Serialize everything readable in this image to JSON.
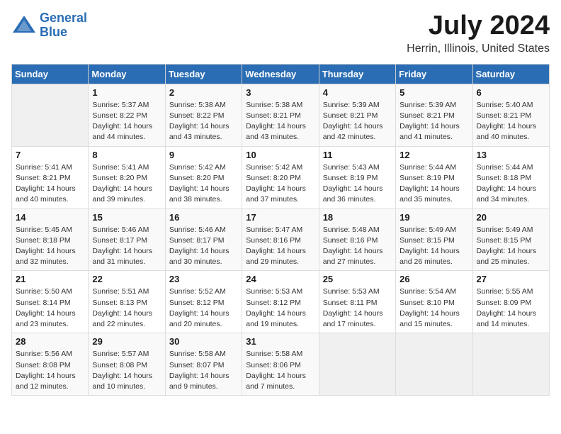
{
  "header": {
    "logo_line1": "General",
    "logo_line2": "Blue",
    "title": "July 2024",
    "location": "Herrin, Illinois, United States"
  },
  "calendar": {
    "days_of_week": [
      "Sunday",
      "Monday",
      "Tuesday",
      "Wednesday",
      "Thursday",
      "Friday",
      "Saturday"
    ],
    "weeks": [
      [
        {
          "day": "",
          "info": ""
        },
        {
          "day": "1",
          "info": "Sunrise: 5:37 AM\nSunset: 8:22 PM\nDaylight: 14 hours\nand 44 minutes."
        },
        {
          "day": "2",
          "info": "Sunrise: 5:38 AM\nSunset: 8:22 PM\nDaylight: 14 hours\nand 43 minutes."
        },
        {
          "day": "3",
          "info": "Sunrise: 5:38 AM\nSunset: 8:21 PM\nDaylight: 14 hours\nand 43 minutes."
        },
        {
          "day": "4",
          "info": "Sunrise: 5:39 AM\nSunset: 8:21 PM\nDaylight: 14 hours\nand 42 minutes."
        },
        {
          "day": "5",
          "info": "Sunrise: 5:39 AM\nSunset: 8:21 PM\nDaylight: 14 hours\nand 41 minutes."
        },
        {
          "day": "6",
          "info": "Sunrise: 5:40 AM\nSunset: 8:21 PM\nDaylight: 14 hours\nand 40 minutes."
        }
      ],
      [
        {
          "day": "7",
          "info": "Sunrise: 5:41 AM\nSunset: 8:21 PM\nDaylight: 14 hours\nand 40 minutes."
        },
        {
          "day": "8",
          "info": "Sunrise: 5:41 AM\nSunset: 8:20 PM\nDaylight: 14 hours\nand 39 minutes."
        },
        {
          "day": "9",
          "info": "Sunrise: 5:42 AM\nSunset: 8:20 PM\nDaylight: 14 hours\nand 38 minutes."
        },
        {
          "day": "10",
          "info": "Sunrise: 5:42 AM\nSunset: 8:20 PM\nDaylight: 14 hours\nand 37 minutes."
        },
        {
          "day": "11",
          "info": "Sunrise: 5:43 AM\nSunset: 8:19 PM\nDaylight: 14 hours\nand 36 minutes."
        },
        {
          "day": "12",
          "info": "Sunrise: 5:44 AM\nSunset: 8:19 PM\nDaylight: 14 hours\nand 35 minutes."
        },
        {
          "day": "13",
          "info": "Sunrise: 5:44 AM\nSunset: 8:18 PM\nDaylight: 14 hours\nand 34 minutes."
        }
      ],
      [
        {
          "day": "14",
          "info": "Sunrise: 5:45 AM\nSunset: 8:18 PM\nDaylight: 14 hours\nand 32 minutes."
        },
        {
          "day": "15",
          "info": "Sunrise: 5:46 AM\nSunset: 8:17 PM\nDaylight: 14 hours\nand 31 minutes."
        },
        {
          "day": "16",
          "info": "Sunrise: 5:46 AM\nSunset: 8:17 PM\nDaylight: 14 hours\nand 30 minutes."
        },
        {
          "day": "17",
          "info": "Sunrise: 5:47 AM\nSunset: 8:16 PM\nDaylight: 14 hours\nand 29 minutes."
        },
        {
          "day": "18",
          "info": "Sunrise: 5:48 AM\nSunset: 8:16 PM\nDaylight: 14 hours\nand 27 minutes."
        },
        {
          "day": "19",
          "info": "Sunrise: 5:49 AM\nSunset: 8:15 PM\nDaylight: 14 hours\nand 26 minutes."
        },
        {
          "day": "20",
          "info": "Sunrise: 5:49 AM\nSunset: 8:15 PM\nDaylight: 14 hours\nand 25 minutes."
        }
      ],
      [
        {
          "day": "21",
          "info": "Sunrise: 5:50 AM\nSunset: 8:14 PM\nDaylight: 14 hours\nand 23 minutes."
        },
        {
          "day": "22",
          "info": "Sunrise: 5:51 AM\nSunset: 8:13 PM\nDaylight: 14 hours\nand 22 minutes."
        },
        {
          "day": "23",
          "info": "Sunrise: 5:52 AM\nSunset: 8:12 PM\nDaylight: 14 hours\nand 20 minutes."
        },
        {
          "day": "24",
          "info": "Sunrise: 5:53 AM\nSunset: 8:12 PM\nDaylight: 14 hours\nand 19 minutes."
        },
        {
          "day": "25",
          "info": "Sunrise: 5:53 AM\nSunset: 8:11 PM\nDaylight: 14 hours\nand 17 minutes."
        },
        {
          "day": "26",
          "info": "Sunrise: 5:54 AM\nSunset: 8:10 PM\nDaylight: 14 hours\nand 15 minutes."
        },
        {
          "day": "27",
          "info": "Sunrise: 5:55 AM\nSunset: 8:09 PM\nDaylight: 14 hours\nand 14 minutes."
        }
      ],
      [
        {
          "day": "28",
          "info": "Sunrise: 5:56 AM\nSunset: 8:08 PM\nDaylight: 14 hours\nand 12 minutes."
        },
        {
          "day": "29",
          "info": "Sunrise: 5:57 AM\nSunset: 8:08 PM\nDaylight: 14 hours\nand 10 minutes."
        },
        {
          "day": "30",
          "info": "Sunrise: 5:58 AM\nSunset: 8:07 PM\nDaylight: 14 hours\nand 9 minutes."
        },
        {
          "day": "31",
          "info": "Sunrise: 5:58 AM\nSunset: 8:06 PM\nDaylight: 14 hours\nand 7 minutes."
        },
        {
          "day": "",
          "info": ""
        },
        {
          "day": "",
          "info": ""
        },
        {
          "day": "",
          "info": ""
        }
      ]
    ]
  }
}
